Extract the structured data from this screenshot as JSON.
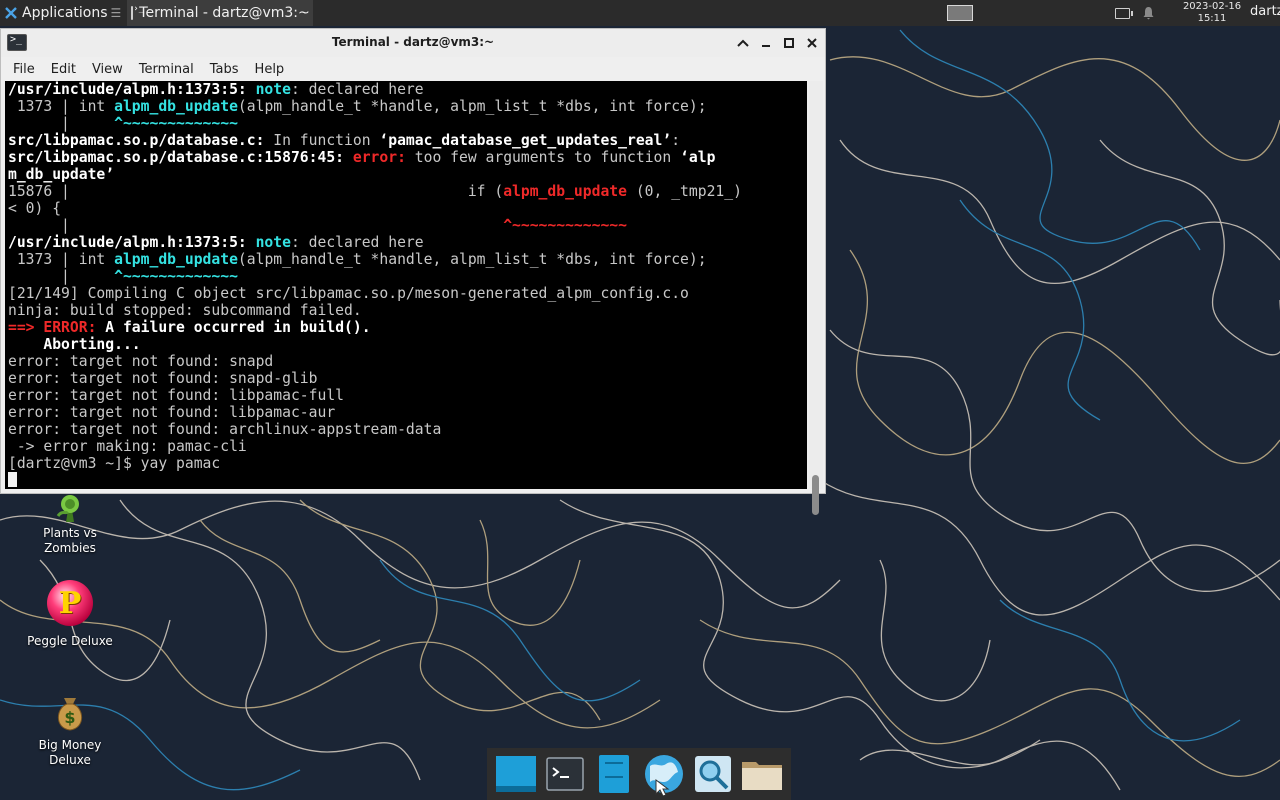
{
  "top_panel": {
    "applications_label": "Applications",
    "task_label": "Terminal - dartz@vm3:~",
    "clock_date": "2023-02-16",
    "clock_time": "15:11",
    "user": "dartz"
  },
  "window": {
    "title": "Terminal - dartz@vm3:~",
    "menu": [
      "File",
      "Edit",
      "View",
      "Terminal",
      "Tabs",
      "Help"
    ]
  },
  "terminal": {
    "lines": [
      [
        {
          "t": "/usr/include/alpm.h:1373:5: ",
          "c": "b"
        },
        {
          "t": "note",
          "c": "cy"
        },
        {
          "t": ": declared here"
        }
      ],
      [
        {
          "t": " 1373 | int "
        },
        {
          "t": "alpm_db_update",
          "c": "cy"
        },
        {
          "t": "(alpm_handle_t *handle, alpm_list_t *dbs, int force);"
        }
      ],
      [
        {
          "t": "      |     "
        },
        {
          "t": "^~~~~~~~~~~~~~",
          "c": "cy"
        }
      ],
      [
        {
          "t": "src/libpamac.so.p/database.c:",
          "c": "b"
        },
        {
          "t": " In function "
        },
        {
          "t": "‘pamac_database_get_updates_real’",
          "c": "b"
        },
        {
          "t": ":"
        }
      ],
      [
        {
          "t": "src/libpamac.so.p/database.c:15876:45: ",
          "c": "b"
        },
        {
          "t": "error:",
          "c": "rd"
        },
        {
          "t": " too few arguments to function "
        },
        {
          "t": "‘alp",
          "c": "b"
        }
      ],
      [
        {
          "t": "m_db_update’",
          "c": "b"
        }
      ],
      [
        {
          "t": "15876 |                                             if ("
        },
        {
          "t": "alpm_db_update",
          "c": "rd"
        },
        {
          "t": " (0, _tmp21_)"
        }
      ],
      [
        {
          "t": "< 0) {"
        }
      ],
      [
        {
          "t": "      |                                                 "
        },
        {
          "t": "^~~~~~~~~~~~~~",
          "c": "rd"
        }
      ],
      [
        {
          "t": "/usr/include/alpm.h:1373:5: ",
          "c": "b"
        },
        {
          "t": "note",
          "c": "cy"
        },
        {
          "t": ": declared here"
        }
      ],
      [
        {
          "t": " 1373 | int "
        },
        {
          "t": "alpm_db_update",
          "c": "cy"
        },
        {
          "t": "(alpm_handle_t *handle, alpm_list_t *dbs, int force);"
        }
      ],
      [
        {
          "t": "      |     "
        },
        {
          "t": "^~~~~~~~~~~~~~",
          "c": "cy"
        }
      ],
      [
        {
          "t": "[21/149] Compiling C object src/libpamac.so.p/meson-generated_alpm_config.c.o"
        }
      ],
      [
        {
          "t": "ninja: build stopped: subcommand failed."
        }
      ],
      [
        {
          "t": "==> ",
          "c": "rd"
        },
        {
          "t": "ERROR:",
          "c": "rd"
        },
        {
          "t": " A failure occurred in build().",
          "c": "b"
        }
      ],
      [
        {
          "t": "    Aborting...",
          "c": "b"
        }
      ],
      [
        {
          "t": "error: target not found: snapd"
        }
      ],
      [
        {
          "t": "error: target not found: snapd-glib"
        }
      ],
      [
        {
          "t": "error: target not found: libpamac-full"
        }
      ],
      [
        {
          "t": "error: target not found: libpamac-aur"
        }
      ],
      [
        {
          "t": "error: target not found: archlinux-appstream-data"
        }
      ],
      [
        {
          "t": " -> error making: pamac-cli"
        }
      ],
      [
        {
          "t": "[dartz@vm3 ~]$ yay pamac"
        }
      ],
      [
        {
          "t": "",
          "cursor": true
        }
      ]
    ]
  },
  "desktop_icons": [
    {
      "label": "Plants vs\nZombies",
      "icon": "plants-vs-zombies-icon"
    },
    {
      "label": "Peggle Deluxe",
      "icon": "peggle-icon"
    },
    {
      "label": "Big Money\nDeluxe",
      "icon": "money-bag-icon"
    }
  ],
  "dock": [
    "show-desktop-icon",
    "terminal-icon",
    "file-manager-icon",
    "web-browser-icon",
    "app-finder-icon",
    "folder-icon"
  ],
  "colors": {
    "panel": "#2b2b2b",
    "wallpaper": "#1b2535",
    "terminal_bg": "#000000",
    "error_red": "#ef2929",
    "note_cyan": "#34e2e2"
  }
}
